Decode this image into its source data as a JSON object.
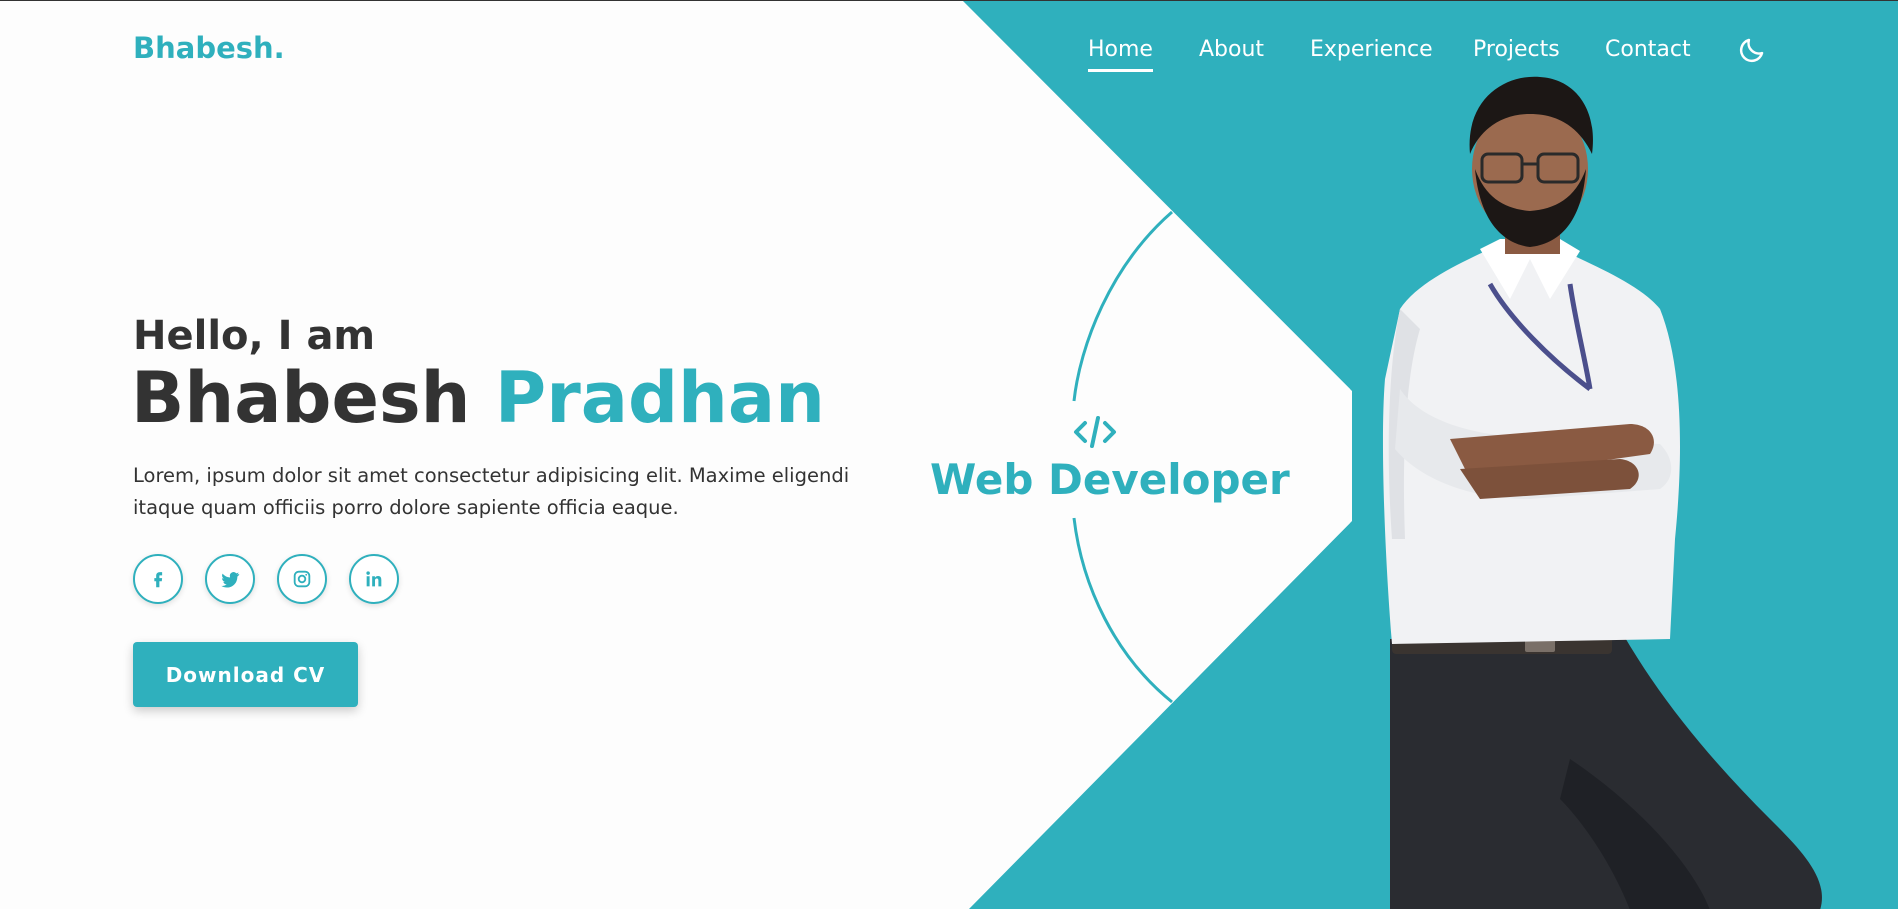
{
  "brand": {
    "name": "Bhabesh."
  },
  "nav": {
    "items": [
      {
        "label": "Home",
        "active": true
      },
      {
        "label": "About",
        "active": false
      },
      {
        "label": "Experience",
        "active": false
      },
      {
        "label": "Projects",
        "active": false
      },
      {
        "label": "Contact",
        "active": false
      }
    ],
    "theme_icon": "moon-icon"
  },
  "hero": {
    "greeting": "Hello, I am",
    "first_name": "Bhabesh",
    "last_name": "Pradhan",
    "description": "Lorem, ipsum dolor sit amet consectetur adipisicing elit. Maxime eligendi itaque quam officiis porro dolore sapiente officia eaque.",
    "cta_label": "Download CV"
  },
  "socials": [
    {
      "icon": "facebook-icon"
    },
    {
      "icon": "twitter-icon"
    },
    {
      "icon": "instagram-icon"
    },
    {
      "icon": "linkedin-icon"
    }
  ],
  "role": {
    "icon": "code-icon",
    "title": "Web Developer"
  },
  "colors": {
    "accent": "#2fb0bd",
    "text": "#333333",
    "background": "#fdfdfd",
    "nav_text": "#ffffff"
  }
}
